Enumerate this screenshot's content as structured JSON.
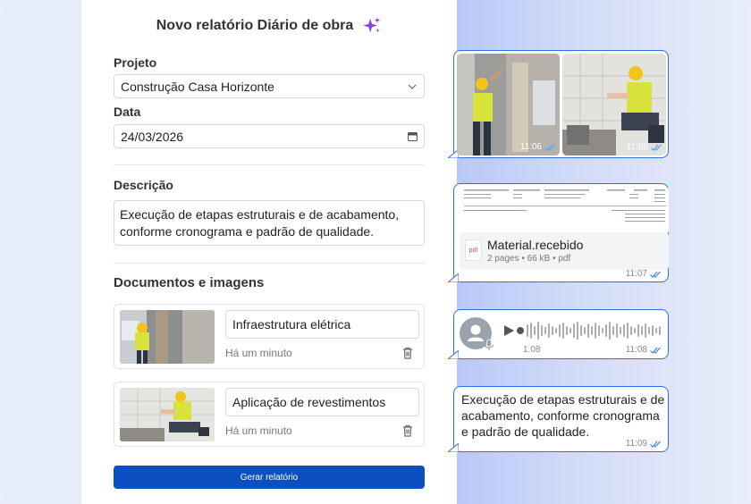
{
  "form": {
    "title": "Novo relatório Diário de obra",
    "project_label": "Projeto",
    "project_value": "Construção Casa Horizonte",
    "date_label": "Data",
    "date_value": "24/03/2026",
    "description_label": "Descrição",
    "description_value": "Execução de etapas estruturais e de acabamento, conforme cronograma e padrão de qualidade.",
    "documents_title": "Documentos e imagens",
    "documents": [
      {
        "name": "Infraestrutura elétrica",
        "time": "Há um minuto"
      },
      {
        "name": "Aplicação de revestimentos",
        "time": "Há um minuto"
      }
    ],
    "generate_button": "Gerar relatório"
  },
  "chat": {
    "photos_time_1": "11:06",
    "photos_time_2": "11:06",
    "pdf_name": "Material.recebido",
    "pdf_meta": "2 pages • 66 kB • pdf",
    "pdf_icon_label": "pdf",
    "pdf_time": "11:07",
    "audio_duration": "1:08",
    "audio_time": "11:08",
    "text_message": "Execução de etapas estruturais e de acabamento, conforme cronograma e padrão de qualidade.",
    "text_time": "11:09"
  },
  "colors": {
    "accent": "#0b4fc3",
    "bubble_border": "#2f6ee5",
    "sparkle": "#8a3ff0",
    "read_check": "#3b82f6"
  },
  "icons": [
    "sparkle-icon",
    "chevron-down-icon",
    "calendar-icon",
    "trash-icon",
    "play-icon",
    "microphone-icon",
    "user-icon",
    "double-check-icon",
    "pdf-icon"
  ]
}
